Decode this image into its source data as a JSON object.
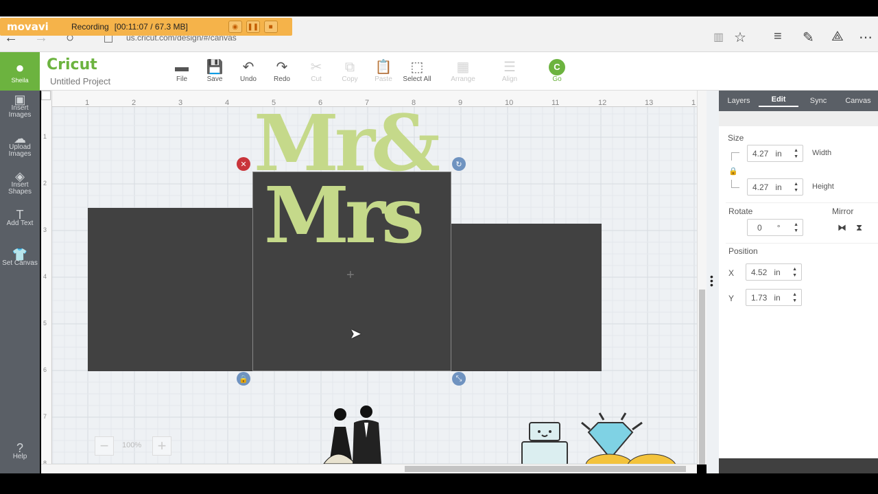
{
  "recorder": {
    "logo": "movavi",
    "status": "Recording",
    "info": "[00:11:07 / 67.3 MB]"
  },
  "browser": {
    "url": "us.cricut.com/design/#/canvas"
  },
  "app": {
    "brand": "Cricut",
    "project_title": "Untitled Project",
    "user": "Sheila"
  },
  "toolbar": [
    {
      "label": "File",
      "icon": "folder-icon",
      "enabled": true
    },
    {
      "label": "Save",
      "icon": "save-icon",
      "enabled": true
    },
    {
      "label": "Undo",
      "icon": "undo-icon",
      "enabled": true
    },
    {
      "label": "Redo",
      "icon": "redo-icon",
      "enabled": true
    },
    {
      "label": "Cut",
      "icon": "cut-icon",
      "enabled": false
    },
    {
      "label": "Copy",
      "icon": "copy-icon",
      "enabled": false
    },
    {
      "label": "Paste",
      "icon": "paste-icon",
      "enabled": false
    },
    {
      "label": "Select All",
      "icon": "select-all-icon",
      "enabled": true
    },
    {
      "label": "Arrange",
      "icon": "arrange-icon",
      "enabled": false
    },
    {
      "label": "Align",
      "icon": "align-icon",
      "enabled": false
    },
    {
      "label": "Go",
      "icon": "go-icon",
      "enabled": true
    }
  ],
  "sidebar": [
    {
      "label1": "Insert",
      "label2": "Images",
      "icon": "image-icon"
    },
    {
      "label1": "Upload",
      "label2": "Images",
      "icon": "upload-icon"
    },
    {
      "label1": "Insert",
      "label2": "Shapes",
      "icon": "shapes-icon"
    },
    {
      "label1": "Add Text",
      "label2": "",
      "icon": "text-icon"
    },
    {
      "label1": "Set Canvas",
      "label2": "",
      "icon": "shirt-icon"
    }
  ],
  "help_label": "Help",
  "ruler": {
    "top": [
      "1",
      "2",
      "3",
      "4",
      "5",
      "6",
      "7",
      "8",
      "9",
      "10",
      "11",
      "12",
      "13",
      "1"
    ],
    "left": [
      "1",
      "2",
      "3",
      "4",
      "5",
      "6",
      "7",
      "8"
    ]
  },
  "design_text": {
    "line1": "Mr&",
    "line2": "Mrs"
  },
  "zoom": {
    "value": "100%",
    "minus": "−",
    "plus": "+"
  },
  "panel": {
    "tabs": [
      "Layers",
      "Edit",
      "Sync",
      "Canvas"
    ],
    "active_tab": "Edit",
    "size_label": "Size",
    "width_value": "4.27",
    "width_label": "Width",
    "height_value": "4.27",
    "height_label": "Height",
    "unit": "in",
    "rotate_label": "Rotate",
    "rotate_value": "0",
    "rotate_unit": "°",
    "mirror_label": "Mirror",
    "position_label": "Position",
    "x_label": "X",
    "x_value": "4.52",
    "y_label": "Y",
    "y_value": "1.73"
  },
  "colors": {
    "accent": "#6cb33f",
    "sidebar": "#5a5f66",
    "design": "#c5d98a",
    "panel_dark": "#404040"
  }
}
